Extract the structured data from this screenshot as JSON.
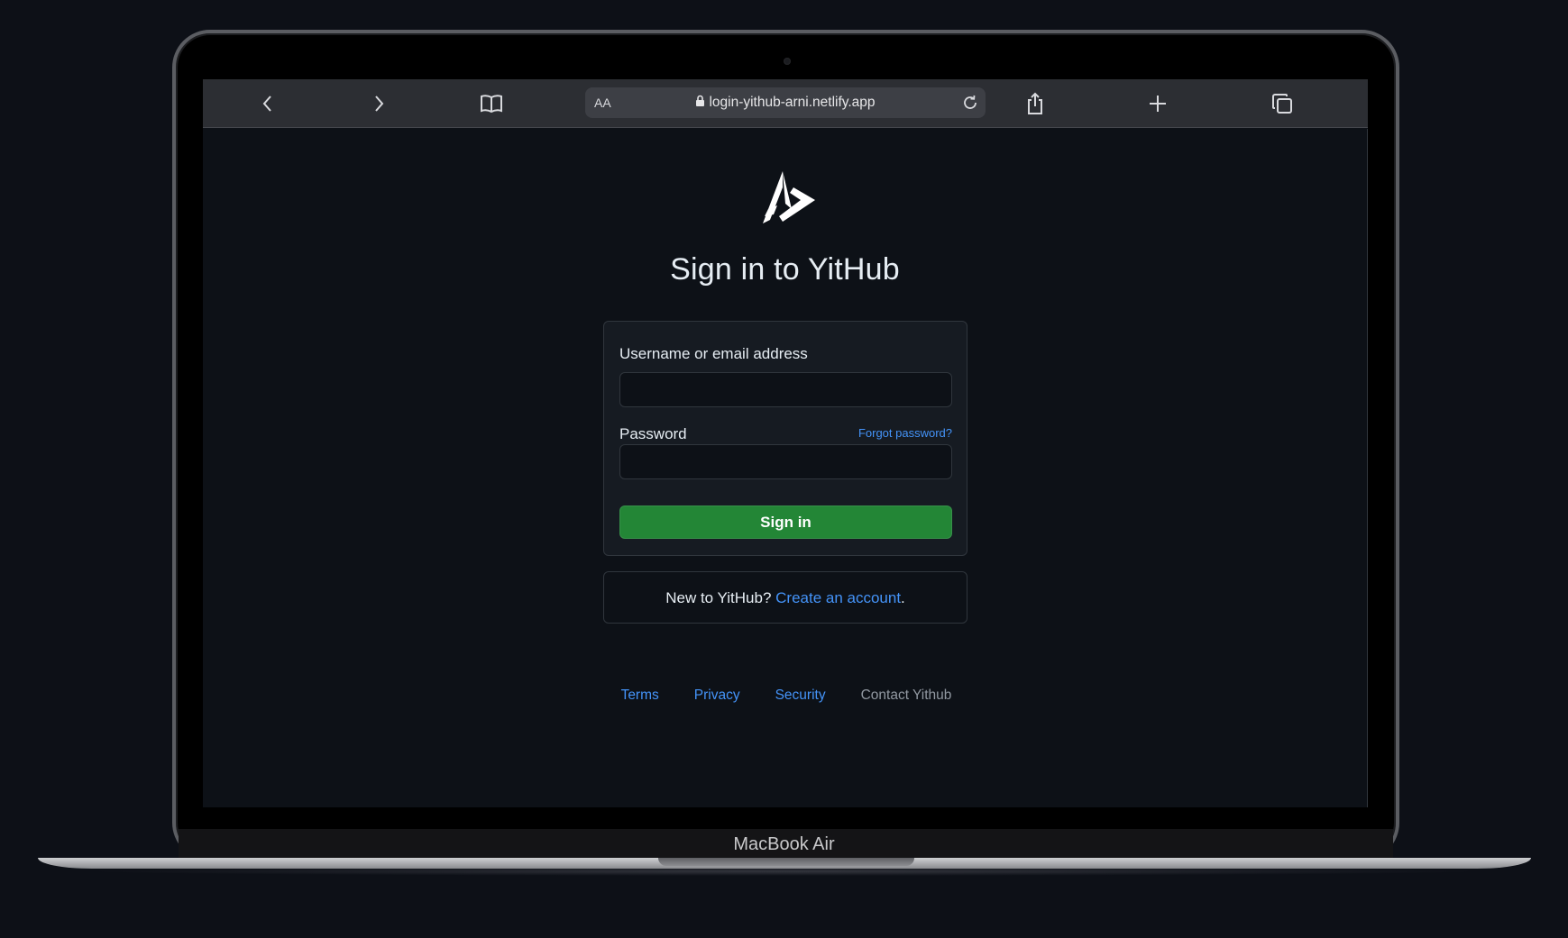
{
  "device": {
    "brand_label": "MacBook Air"
  },
  "browser": {
    "text_size_label": "AA",
    "url": "login-yithub-arni.netlify.app",
    "icons": [
      "back-icon",
      "forward-icon",
      "bookmarks-icon",
      "lock-icon",
      "reload-icon",
      "share-icon",
      "new-tab-icon",
      "tabs-icon"
    ]
  },
  "page": {
    "title": "Sign in to YitHub",
    "form": {
      "username_label": "Username or email address",
      "username_value": "",
      "password_label": "Password",
      "password_value": "",
      "forgot_password": "Forgot password?",
      "submit_label": "Sign in"
    },
    "signup": {
      "prompt": "New to YitHub?",
      "link": "Create an account",
      "suffix": "."
    },
    "footer": {
      "links": [
        "Terms",
        "Privacy",
        "Security",
        "Contact Yithub"
      ]
    }
  },
  "colors": {
    "background": "#0d1117",
    "accent_link": "#4493f8",
    "primary_button": "#238636",
    "card_bg": "#161b22",
    "border": "#30363d"
  }
}
